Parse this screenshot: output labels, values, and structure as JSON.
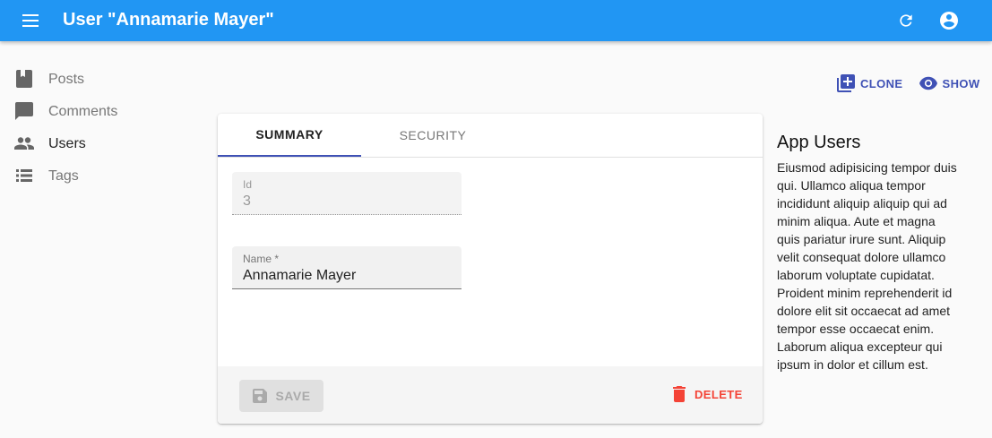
{
  "appbar": {
    "title": "User \"Annamarie Mayer\"",
    "icons": {
      "menu": "menu-icon",
      "refresh": "refresh-icon",
      "account": "account-circle-icon"
    },
    "color": "#2196f3"
  },
  "sidebar": {
    "items": [
      {
        "label": "Posts",
        "icon": "book-icon",
        "active": false
      },
      {
        "label": "Comments",
        "icon": "chat-bubble-icon",
        "active": false
      },
      {
        "label": "Users",
        "icon": "people-icon",
        "active": true
      },
      {
        "label": "Tags",
        "icon": "list-icon",
        "active": false
      }
    ]
  },
  "actions": {
    "clone_label": "CLONE",
    "show_label": "SHOW",
    "accent": "#3f51b5"
  },
  "tabs": [
    {
      "label": "SUMMARY",
      "selected": true
    },
    {
      "label": "SECURITY",
      "selected": false
    }
  ],
  "form": {
    "id_label": "Id",
    "id_value": "3",
    "name_label": "Name *",
    "name_value": "Annamarie Mayer"
  },
  "toolbar": {
    "save_label": "SAVE",
    "delete_label": "DELETE",
    "delete_color": "#f44336"
  },
  "aside": {
    "title": "App Users",
    "text": "Eiusmod adipisicing tempor duis qui. Ullamco aliqua tempor incididunt aliquip aliquip qui ad minim aliqua. Aute et magna quis pariatur irure sunt. Aliquip velit consequat dolore ullamco laborum voluptate cupidatat. Proident minim reprehenderit id dolore elit sit occaecat ad amet tempor esse occaecat enim. Laborum aliqua excepteur qui ipsum in dolor et cillum est."
  }
}
